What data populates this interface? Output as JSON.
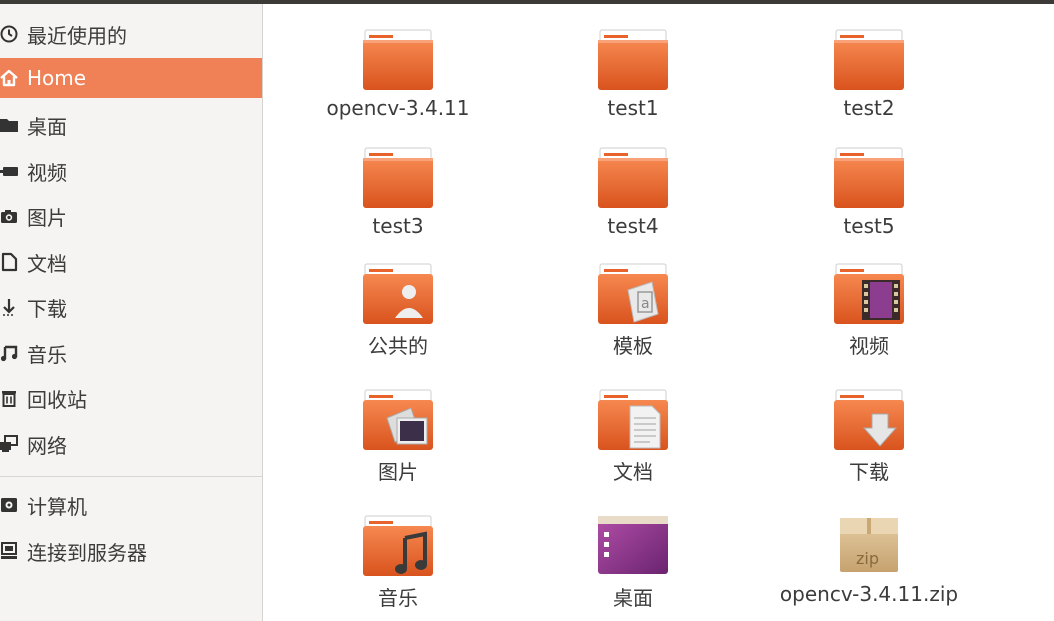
{
  "sidebar": {
    "items": [
      {
        "label": "最近使用的",
        "icon": "clock-icon",
        "active": false
      },
      {
        "label": "Home",
        "icon": "home-icon",
        "active": true
      },
      {
        "label": "桌面",
        "icon": "folder-icon",
        "active": false
      },
      {
        "label": "视频",
        "icon": "video-camera-icon",
        "active": false
      },
      {
        "label": "图片",
        "icon": "camera-icon",
        "active": false
      },
      {
        "label": "文档",
        "icon": "document-icon",
        "active": false
      },
      {
        "label": "下载",
        "icon": "download-arrow-icon",
        "active": false
      },
      {
        "label": "音乐",
        "icon": "music-note-icon",
        "active": false
      },
      {
        "label": "回收站",
        "icon": "trash-icon",
        "active": false
      },
      {
        "label": "网络",
        "icon": "network-icon",
        "active": false
      },
      {
        "label": "计算机",
        "icon": "computer-icon",
        "active": false
      },
      {
        "label": "连接到服务器",
        "icon": "server-connect-icon",
        "active": false
      }
    ]
  },
  "files": [
    {
      "name": "opencv-3.4.11",
      "icon": "folder-icon"
    },
    {
      "name": "test1",
      "icon": "folder-icon"
    },
    {
      "name": "test2",
      "icon": "folder-icon"
    },
    {
      "name": "test3",
      "icon": "folder-icon"
    },
    {
      "name": "test4",
      "icon": "folder-icon"
    },
    {
      "name": "test5",
      "icon": "folder-icon"
    },
    {
      "name": "公共的",
      "icon": "public-folder-icon"
    },
    {
      "name": "模板",
      "icon": "templates-folder-icon"
    },
    {
      "name": "视频",
      "icon": "videos-folder-icon"
    },
    {
      "name": "图片",
      "icon": "pictures-folder-icon"
    },
    {
      "name": "文档",
      "icon": "documents-folder-icon"
    },
    {
      "name": "下载",
      "icon": "downloads-folder-icon"
    },
    {
      "name": "音乐",
      "icon": "music-folder-icon"
    },
    {
      "name": "桌面",
      "icon": "desktop-folder-icon"
    },
    {
      "name": "opencv-3.4.11.zip",
      "icon": "zip-archive-icon"
    }
  ],
  "colors": {
    "accent": "#f08055",
    "folder_orange": "#e8622c",
    "sidebar_bg": "#f5f4f2",
    "text": "#3c3c3c"
  }
}
